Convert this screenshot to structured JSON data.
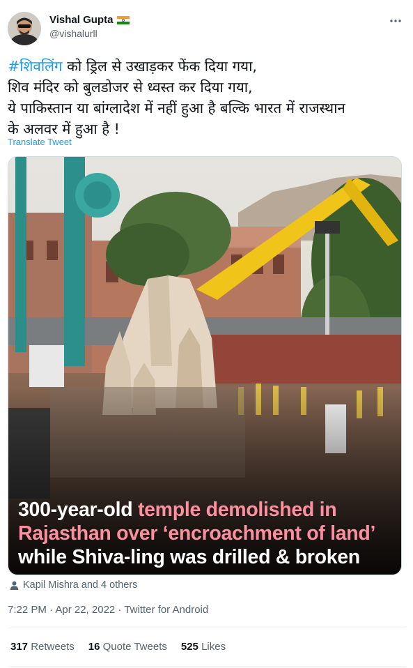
{
  "author": {
    "display_name": "Vishal Gupta",
    "handle": "@vishalurll",
    "flag_icon": "india-flag-icon"
  },
  "tweet": {
    "hashtag": "#शिवलिंग",
    "line1_rest": " को ड्रिल से उखाड़कर फेंक दिया गया,",
    "line2": "शिव मंदिर को बुलडोजर से ध्वस्त कर दिया गया,",
    "line3": "ये पाकिस्तान या बांग्लादेश में नहीं हुआ है बल्कि भारत में राजस्थान",
    "line4": "के अलवर में हुआ है !",
    "translate_label": "Translate Tweet"
  },
  "media": {
    "caption": {
      "l1_white": "300-year-old ",
      "l1_pink": "temple demolished in",
      "l2_pink": "Rajasthan over ‘encroachment of land’",
      "l3_white": "while Shiva-ling was drilled & broken"
    }
  },
  "tagged": {
    "icon": "person-icon",
    "text": "Kapil Mishra and 4 others"
  },
  "meta": {
    "time": "7:22 PM · Apr 22, 2022 · Twitter for Android"
  },
  "stats": {
    "retweets_count": "317",
    "retweets_label": "Retweets",
    "quote_count": "16",
    "quote_label": "Quote Tweets",
    "likes_count": "525",
    "likes_label": "Likes"
  },
  "colors": {
    "link": "#1d9bf0",
    "secondary_text": "#536471",
    "caption_highlight": "#ff8fa0"
  }
}
